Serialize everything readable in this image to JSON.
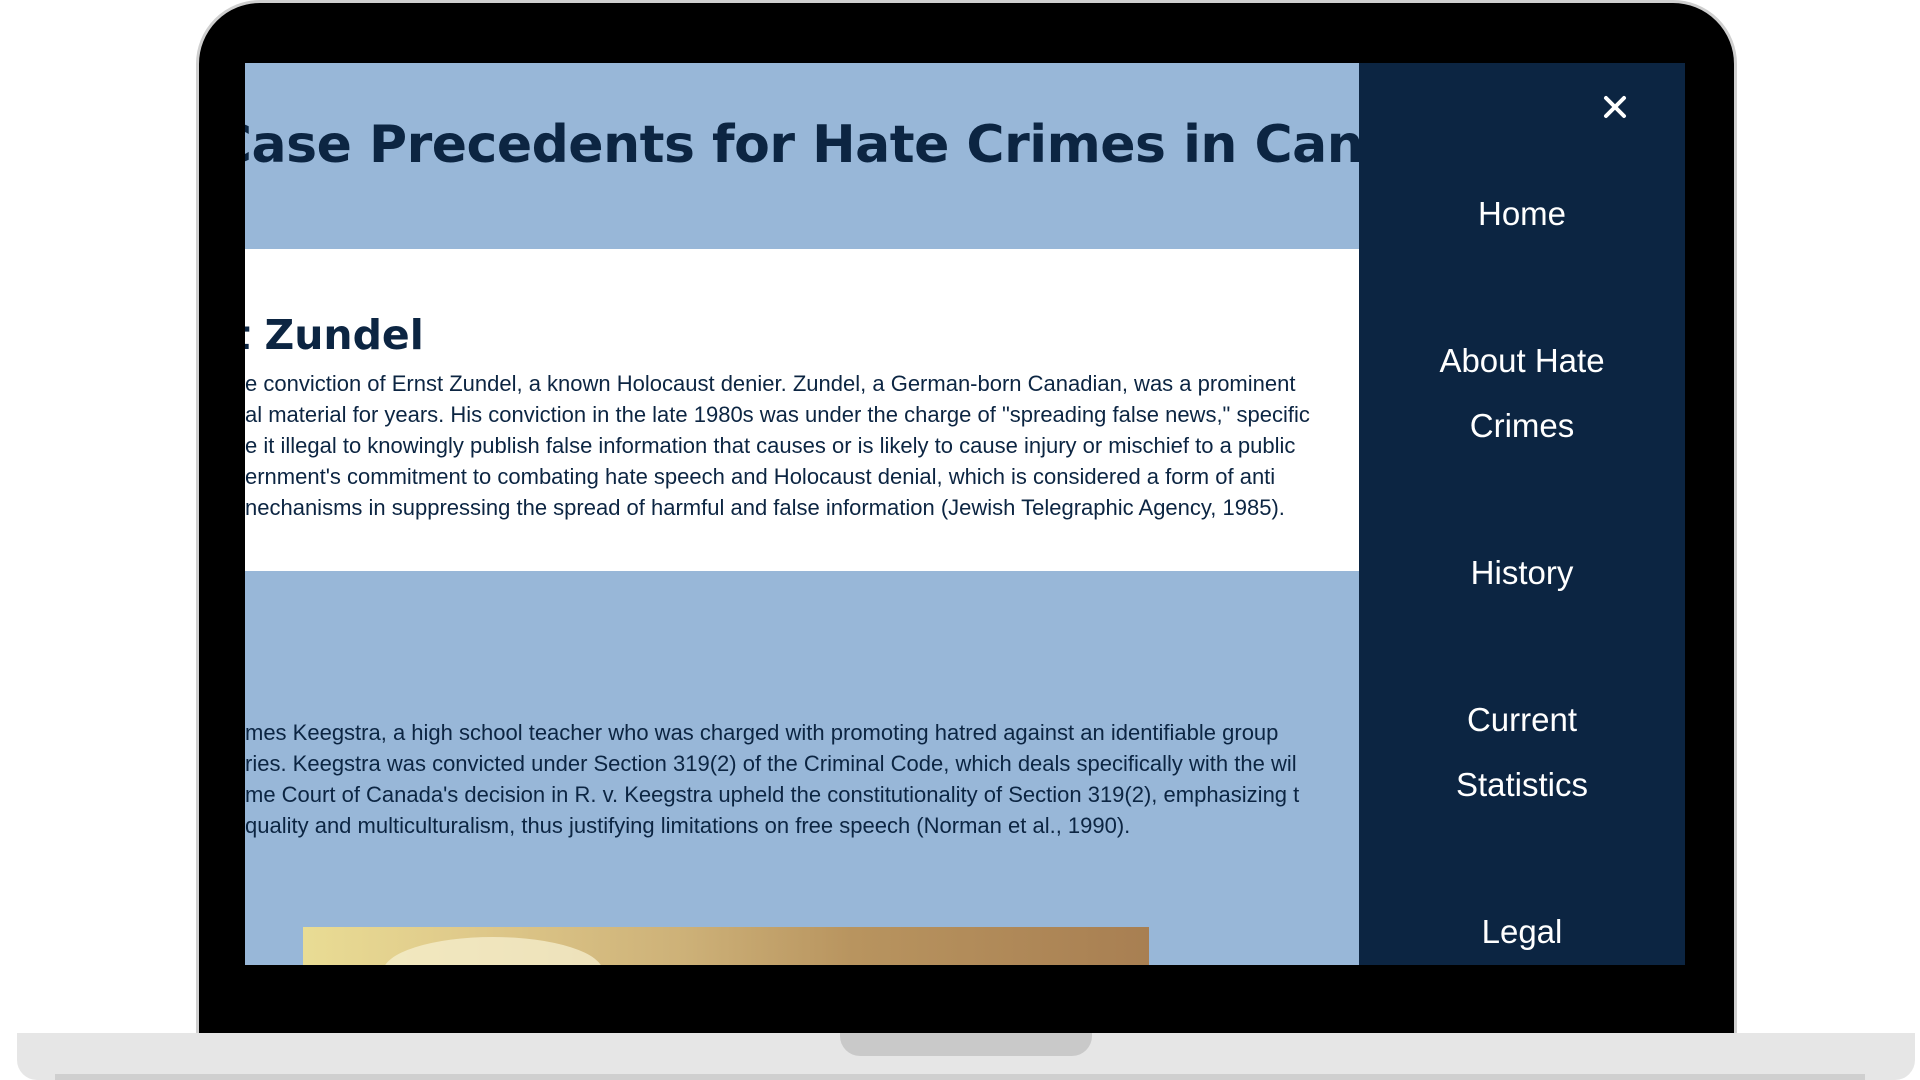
{
  "page": {
    "title": "ne Case Precedents for Hate Crimes in Can",
    "cases": [
      {
        "heading": "nst Zundel",
        "lines": [
          "e conviction of Ernst Zundel, a known Holocaust denier. Zundel, a German-born Canadian, was a prominent",
          "al material for years. His conviction in the late 1980s was under the charge of \"spreading false news,\" specific",
          "e it illegal to knowingly publish false information that causes or is likely to cause injury or mischief to a public",
          "ernment's commitment to combating hate speech and Holocaust denial, which is considered a form of anti",
          "nechanisms in suppressing the spread of harmful and false information (Jewish Telegraphic Agency, 1985)."
        ]
      },
      {
        "heading": "",
        "lines": [
          "mes Keegstra, a high school teacher who was charged with promoting hatred against an identifiable group",
          "ries. Keegstra was convicted under Section 319(2) of the Criminal Code, which deals specifically with the wil",
          "me Court of Canada's decision in R. v. Keegstra upheld the constitutionality of Section 319(2), emphasizing t",
          "quality and multiculturalism, thus justifying limitations on free speech (Norman et al., 1990)."
        ]
      }
    ]
  },
  "nav": {
    "close_icon": "close-x-icon",
    "items": [
      {
        "label": "Home"
      },
      {
        "label": "About Hate Crimes"
      },
      {
        "label": "History"
      },
      {
        "label": "Current Statistics"
      },
      {
        "label": "Legal"
      }
    ]
  },
  "colors": {
    "navy": "#0c2542",
    "light_blue": "#98b7d8",
    "white": "#ffffff"
  }
}
